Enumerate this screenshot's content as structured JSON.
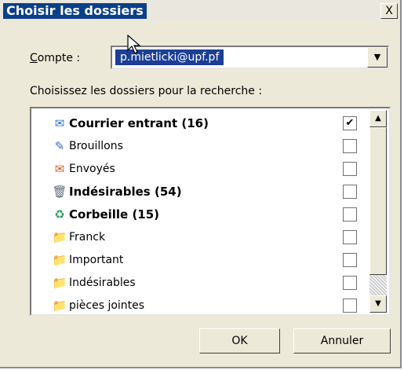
{
  "dialog": {
    "title": "Choisir les dossiers",
    "close_label": "X"
  },
  "account": {
    "label_accel": "C",
    "label_rest": "ompte :",
    "value": "p.mietlicki@upf.pf"
  },
  "instruction": "Choisissez les dossiers pour la recherche :",
  "folders": [
    {
      "label": "Courrier entrant (16)",
      "bold": true,
      "checked": true,
      "icon": "inbox-icon",
      "glyph": "✉",
      "color": "#2d6fd2"
    },
    {
      "label": "Brouillons",
      "bold": false,
      "checked": false,
      "icon": "drafts-icon",
      "glyph": "✎",
      "color": "#2f6bd0"
    },
    {
      "label": "Envoyés",
      "bold": false,
      "checked": false,
      "icon": "sent-icon",
      "glyph": "✉",
      "color": "#d8561c"
    },
    {
      "label": "Indésirables (54)",
      "bold": true,
      "checked": false,
      "icon": "junk-icon",
      "glyph": "🗑",
      "color": "#5a6a7a"
    },
    {
      "label": "Corbeille (15)",
      "bold": true,
      "checked": false,
      "icon": "trash-icon",
      "glyph": "♻",
      "color": "#2a9d59"
    },
    {
      "label": "Franck",
      "bold": false,
      "checked": false,
      "icon": "folder-icon",
      "glyph": "📁",
      "color": "#e0a640"
    },
    {
      "label": "Important",
      "bold": false,
      "checked": false,
      "icon": "folder-icon",
      "glyph": "📁",
      "color": "#e0a640"
    },
    {
      "label": "Indésirables",
      "bold": false,
      "checked": false,
      "icon": "folder-icon",
      "glyph": "📁",
      "color": "#e0a640"
    },
    {
      "label": "pièces jointes",
      "bold": false,
      "checked": false,
      "icon": "folder-icon",
      "glyph": "📁",
      "color": "#e0a640"
    }
  ],
  "buttons": {
    "ok": "OK",
    "cancel": "Annuler"
  },
  "colors": {
    "title_bg": "#0a3f8a",
    "selection": "#1c3f95",
    "dialog_bg": "#ece9d8"
  }
}
